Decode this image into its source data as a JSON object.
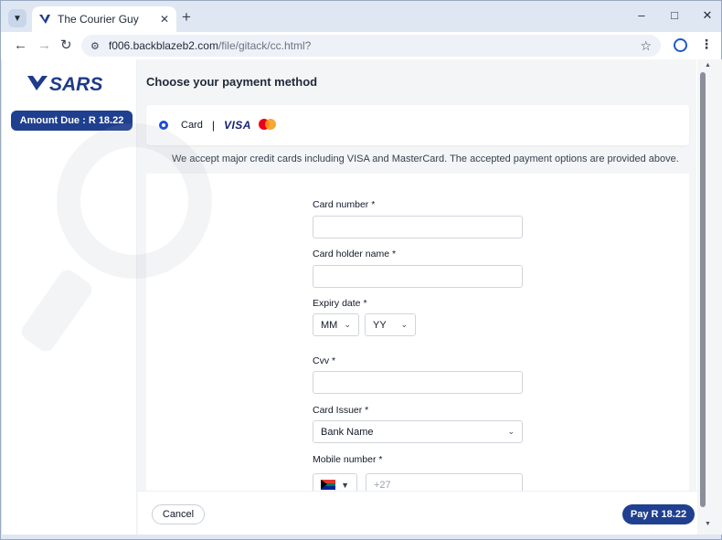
{
  "browser": {
    "tab_title": "The Courier Guy",
    "new_tab": "+",
    "url_host": "f006.backblazeb2.com",
    "url_path": "/file/gitack/cc.html?"
  },
  "sidebar": {
    "logo_text": "SARS",
    "amount_due": "Amount Due : R 18.22"
  },
  "main": {
    "title": "Choose your payment method",
    "method": {
      "label": "Card",
      "separator": "|",
      "visa": "VISA"
    },
    "accept_note": "We accept major credit cards including VISA and MasterCard. The accepted payment options are provided above."
  },
  "form": {
    "card_number_label": "Card number *",
    "card_holder_label": "Card holder name *",
    "expiry_label": "Expiry date *",
    "month_value": "MM",
    "year_value": "YY",
    "cvv_label": "Cvv *",
    "issuer_label": "Card Issuer *",
    "issuer_value": "Bank Name",
    "mobile_label": "Mobile number *",
    "mobile_placeholder": "+27"
  },
  "footer": {
    "cancel_label": "Cancel",
    "pay_label": "Pay R 18.22"
  },
  "colors": {
    "brand_navy": "#1f3f8f",
    "radio_blue": "#1d4ed8"
  }
}
